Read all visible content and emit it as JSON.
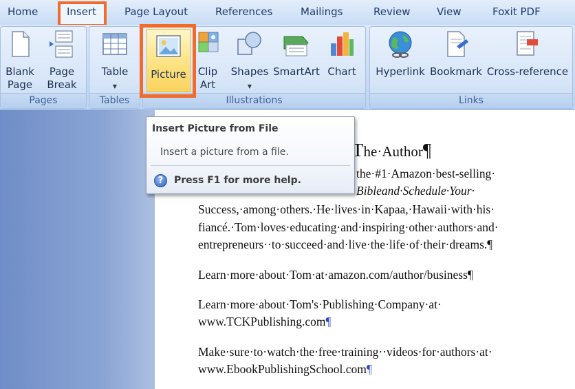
{
  "tabs": [
    "Home",
    "Insert",
    "Page Layout",
    "References",
    "Mailings",
    "Review",
    "View",
    "Foxit PDF"
  ],
  "groups": {
    "pages": {
      "label": "Pages",
      "buttons": [
        {
          "label": "Blank\nPage",
          "icon": "blank-page-icon"
        },
        {
          "label": "Page\nBreak",
          "icon": "page-break-icon"
        }
      ]
    },
    "tables": {
      "label": "Tables",
      "buttons": [
        {
          "label": "Table",
          "icon": "table-icon",
          "dropdown": "▼"
        }
      ]
    },
    "illustrations": {
      "label": "Illustrations",
      "buttons": [
        {
          "label": "Picture",
          "icon": "picture-icon"
        },
        {
          "label": "Clip\nArt",
          "icon": "clip-art-icon"
        },
        {
          "label": "Shapes",
          "icon": "shapes-icon",
          "dropdown": "▼"
        },
        {
          "label": "SmartArt",
          "icon": "smartart-icon"
        },
        {
          "label": "Chart",
          "icon": "chart-icon"
        }
      ]
    },
    "links": {
      "label": "Links",
      "buttons": [
        {
          "label": "Hyperlink",
          "icon": "hyperlink-globe-icon"
        },
        {
          "label": "Bookmark",
          "icon": "bookmark-icon"
        },
        {
          "label": "Cross-reference",
          "icon": "cross-reference-icon"
        }
      ]
    }
  },
  "tooltip": {
    "title": "Insert Picture from File",
    "description": "Insert a picture from a file.",
    "help": "Press F1 for more help.",
    "help_icon": "?"
  },
  "document": {
    "heading_first": "T",
    "heading_rest": "he·Author",
    "pilcrow": "¶",
    "lines": [
      "the·#1·Amazon·best-selling·",
      "Success,·among·others.·He·lives·in·Kapaa,·Hawaii·with·his·",
      "fiancé.·Tom·loves·educating·and·inspiring·other·authors·and·",
      "entrepreneurs··to·succeed·and·live·the·life·of·their·dreams.¶",
      "Learn·more·about·Tom·at·amazon.com/author/business¶",
      "Learn·more·about·Tom's·Publishing·Company·at·",
      "www.TCKPublishing.com",
      "Make·sure·to·watch·the·free·training··videos·for·authors·at·",
      "www.EbookPublishingSchool.com"
    ],
    "partial_line_italic": "Bibleand·Schedule·Your·"
  },
  "colors": {
    "highlight_orange": "#f06b2c",
    "ribbon_blue": "#c9dcf3",
    "pilcrow_blue": "#2b48c9"
  }
}
